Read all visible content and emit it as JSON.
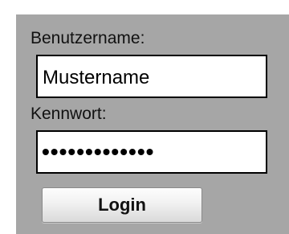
{
  "login_form": {
    "username_label": "Benutzername:",
    "username_value": "Mustername",
    "password_label": "Kennwort:",
    "password_mask": "•••••••••••••",
    "login_label": "Login"
  },
  "colors": {
    "panel_background": "#a6a6a6",
    "field_background": "#ffffff",
    "field_border": "#000000",
    "button_background": "#efefef"
  }
}
